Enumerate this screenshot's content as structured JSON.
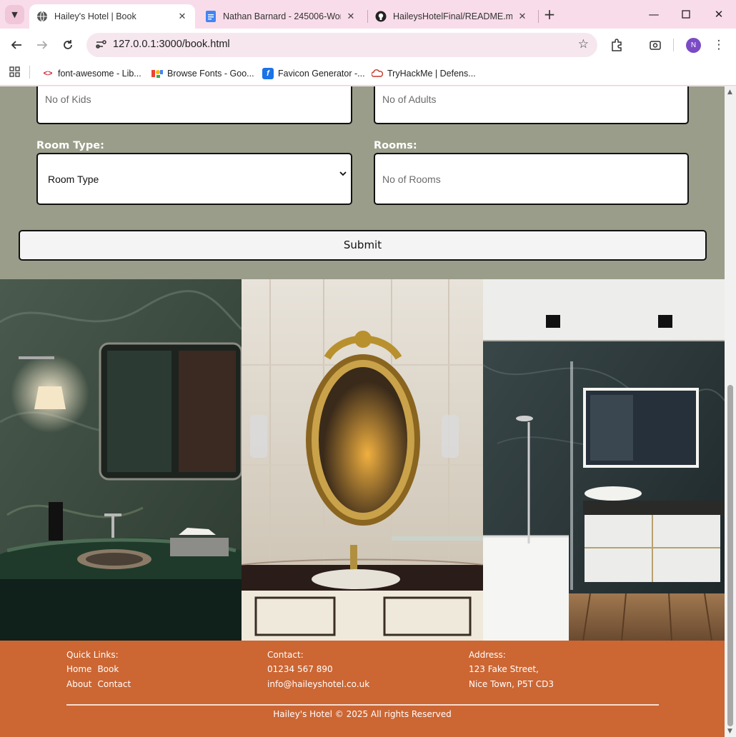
{
  "browser": {
    "tabs": [
      {
        "title": "Hailey's Hotel | Book",
        "active": true,
        "favicon": "globe-icon"
      },
      {
        "title": "Nathan Barnard - 245006-Work",
        "active": false,
        "favicon": "google-docs-icon"
      },
      {
        "title": "HaileysHotelFinal/README.md",
        "active": false,
        "favicon": "github-icon"
      }
    ],
    "url": "127.0.0.1:3000/book.html",
    "profile_initial": "N",
    "bookmarks": [
      {
        "label": "font-awesome - Lib...",
        "icon": "code-icon"
      },
      {
        "label": "Browse Fonts - Goo...",
        "icon": "google-fonts-icon"
      },
      {
        "label": "Favicon Generator -...",
        "icon": "favicon-generator-icon"
      },
      {
        "label": "TryHackMe | Defens...",
        "icon": "tryhackme-icon"
      }
    ]
  },
  "form": {
    "kids_placeholder": "No of Kids",
    "adults_placeholder": "No of Adults",
    "room_type_label": "Room Type:",
    "room_type_selected": "Room Type",
    "rooms_label": "Rooms:",
    "rooms_placeholder": "No of Rooms",
    "submit_label": "Submit"
  },
  "footer": {
    "quick_links_heading": "Quick Links:",
    "links": [
      "Home",
      "Book",
      "About",
      "Contact"
    ],
    "contact_heading": "Contact:",
    "phone": "01234 567 890",
    "email": "info@haileyshotel.co.uk",
    "address_heading": "Address:",
    "address_line1": "123 Fake Street,",
    "address_line2": "Nice Town, P5T CD3",
    "copyright": "Hailey's Hotel © 2025 All rights Reserved"
  },
  "colors": {
    "form_background": "#9a9d89",
    "footer_background": "#cc6633",
    "tab_strip": "#f9dce9"
  }
}
